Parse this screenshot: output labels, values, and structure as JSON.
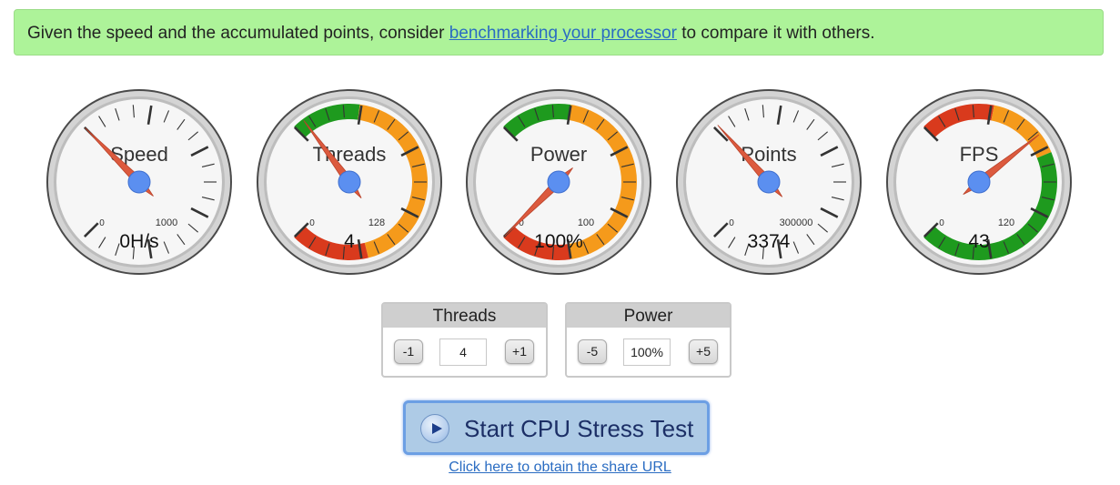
{
  "banner": {
    "text_before": "Given the speed and the accumulated points, consider ",
    "link_text": "benchmarking your processor",
    "text_after": " to compare it with others."
  },
  "gauges": [
    {
      "label": "Speed",
      "min_label": "0",
      "max_label": "1000",
      "min": 0,
      "max": 1000,
      "value": 0,
      "readout": "0H/s",
      "bands": []
    },
    {
      "label": "Threads",
      "min_label": "0",
      "max_label": "128",
      "min": 0,
      "max": 128,
      "value": 4,
      "readout": "4",
      "bands": [
        {
          "from": 0,
          "to": 25,
          "color": "#1e9a1e"
        },
        {
          "from": 25,
          "to": 100,
          "color": "#f59a1b"
        },
        {
          "from": 100,
          "to": 128,
          "color": "#d93a1d"
        }
      ]
    },
    {
      "label": "Power",
      "min_label": "0",
      "max_label": "100",
      "min": 0,
      "max": 100,
      "value": 100,
      "readout": "100%",
      "bands": [
        {
          "from": 0,
          "to": 20,
          "color": "#1e9a1e"
        },
        {
          "from": 20,
          "to": 80,
          "color": "#f59a1b"
        },
        {
          "from": 80,
          "to": 100,
          "color": "#d93a1d"
        }
      ]
    },
    {
      "label": "Points",
      "min_label": "0",
      "max_label": "300000",
      "min": 0,
      "max": 300000,
      "value": 3374,
      "readout": "3374",
      "bands": []
    },
    {
      "label": "FPS",
      "min_label": "0",
      "max_label": "120",
      "min": 0,
      "max": 120,
      "value": 43,
      "readout": "43",
      "bands": [
        {
          "from": 0,
          "to": 25,
          "color": "#d93a1d"
        },
        {
          "from": 25,
          "to": 50,
          "color": "#f59a1b"
        },
        {
          "from": 50,
          "to": 120,
          "color": "#1e9a1e"
        }
      ]
    }
  ],
  "controls": {
    "threads": {
      "title": "Threads",
      "minus": "-1",
      "value": "4",
      "plus": "+1"
    },
    "power": {
      "title": "Power",
      "minus": "-5",
      "value": "100%",
      "plus": "+5"
    }
  },
  "start_button": {
    "label": "Start CPU Stress Test"
  },
  "share_link": {
    "label": "Click here to obtain the share URL"
  }
}
